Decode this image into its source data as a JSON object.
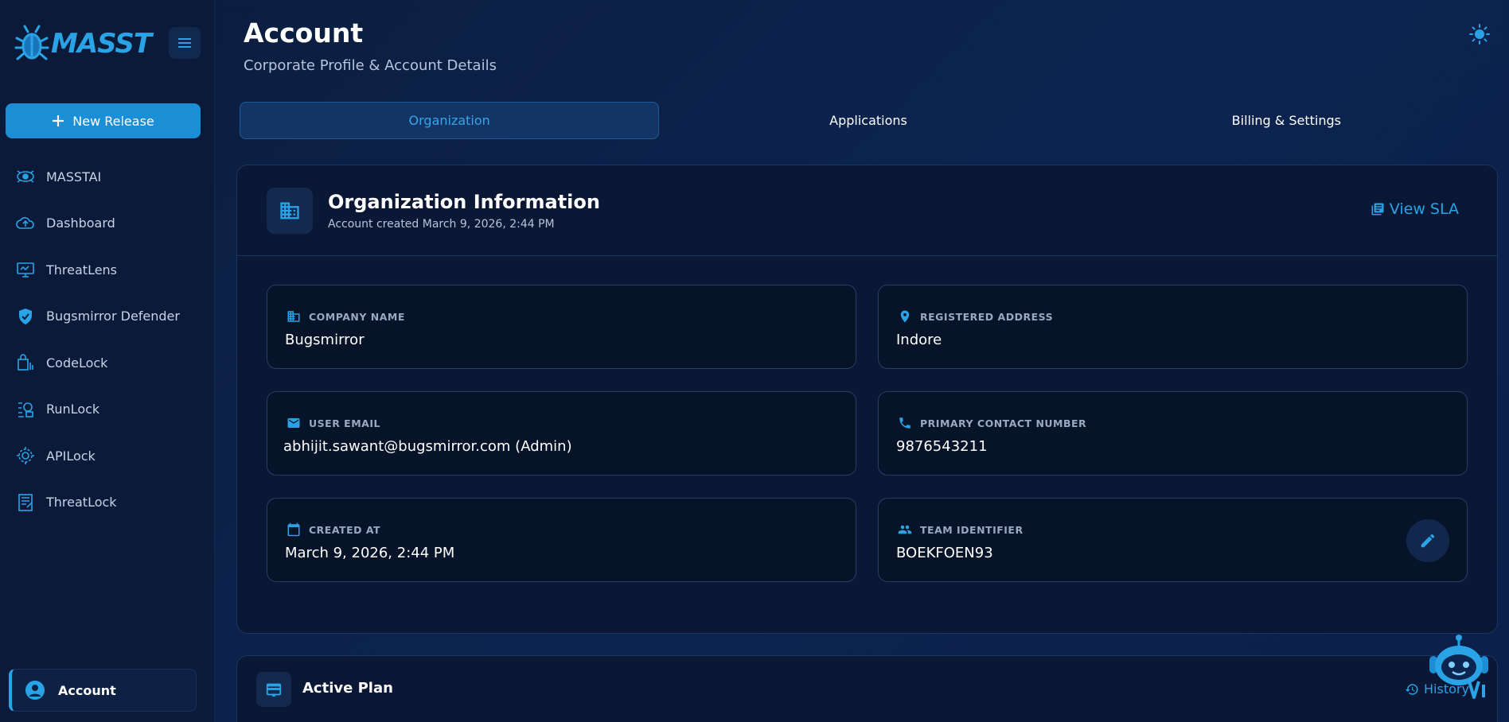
{
  "brand": {
    "name": "MASST"
  },
  "sidebar": {
    "new_release_label": "New Release",
    "items": [
      {
        "label": "MASSTAI",
        "icon": "ai-eye-icon"
      },
      {
        "label": "Dashboard",
        "icon": "cloud-upload-icon"
      },
      {
        "label": "ThreatLens",
        "icon": "monitor-icon"
      },
      {
        "label": "Bugsmirror Defender",
        "icon": "shield-icon"
      },
      {
        "label": "CodeLock",
        "icon": "code-lock-icon"
      },
      {
        "label": "RunLock",
        "icon": "run-lock-icon"
      },
      {
        "label": "APILock",
        "icon": "api-gear-icon"
      },
      {
        "label": "ThreatLock",
        "icon": "threat-lock-icon"
      }
    ],
    "account_label": "Account"
  },
  "header": {
    "title": "Account",
    "subtitle": "Corporate Profile & Account Details"
  },
  "tabs": [
    {
      "label": "Organization",
      "active": true
    },
    {
      "label": "Applications",
      "active": false
    },
    {
      "label": "Billing & Settings",
      "active": false
    }
  ],
  "org": {
    "title": "Organization Information",
    "created_meta": "Account created March 9, 2026, 2:44 PM",
    "view_sla_label": "View SLA",
    "fields": {
      "company_name": {
        "label": "COMPANY NAME",
        "value": "Bugsmirror"
      },
      "registered_address": {
        "label": "REGISTERED ADDRESS",
        "value": "Indore"
      },
      "user_email": {
        "label": "USER EMAIL",
        "value": "abhijit.sawant@bugsmirror.com (Admin)"
      },
      "primary_contact": {
        "label": "PRIMARY CONTACT NUMBER",
        "value": "9876543211"
      },
      "created_at": {
        "label": "CREATED AT",
        "value": "March 9, 2026, 2:44 PM"
      },
      "team_identifier": {
        "label": "TEAM IDENTIFIER",
        "value": "BOEKFOEN93"
      }
    }
  },
  "plan": {
    "title": "Active Plan",
    "history_label": "History"
  },
  "colors": {
    "accent": "#2aa3e6",
    "primary_button": "#1b8ed6",
    "background": "#0b1d3d",
    "card": "#0a1835",
    "field": "#071328"
  }
}
